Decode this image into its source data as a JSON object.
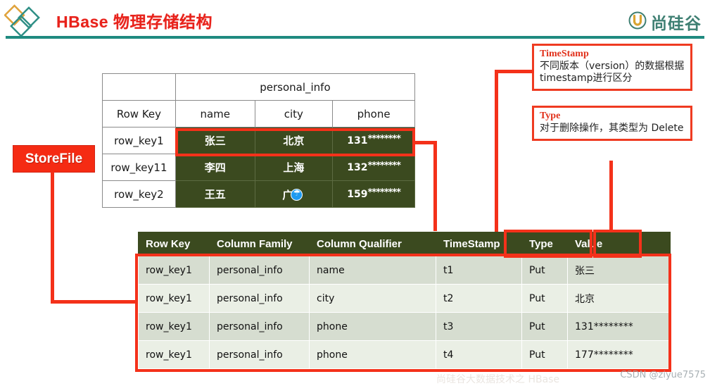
{
  "header": {
    "title": "HBase 物理存储结构",
    "brand_name": "尚硅谷",
    "logo_icon": "diamonds-logo-icon",
    "brand_icon": "u-mark-icon"
  },
  "logical_table": {
    "column_family_label": "personal_info",
    "row_key_header": "Row Key",
    "qualifier_headers": [
      "name",
      "city",
      "phone"
    ],
    "rows": [
      {
        "row_key": "row_key1",
        "name": "张三",
        "city": "北京",
        "city_badge": "umbrella-badge-icon",
        "phone_prefix": "131",
        "phone_stars": "********",
        "highlighted": true
      },
      {
        "row_key": "row_key11",
        "name": "李四",
        "city": "上海",
        "city_badge": "",
        "phone_prefix": "132",
        "phone_stars": "********",
        "highlighted": false
      },
      {
        "row_key": "row_key2",
        "name": "王五",
        "city": "广",
        "city_badge": "umbrella-badge-icon",
        "phone_prefix": "159",
        "phone_stars": "********",
        "highlighted": false
      }
    ]
  },
  "storefile_table": {
    "headers": [
      "Row Key",
      "Column Family",
      "Column Qualifier",
      "TimeStamp",
      "Type",
      "Value"
    ],
    "rows": [
      {
        "row_key": "row_key1",
        "family": "personal_info",
        "qualifier": "name",
        "timestamp": "t1",
        "type": "Put",
        "value": "张三"
      },
      {
        "row_key": "row_key1",
        "family": "personal_info",
        "qualifier": "city",
        "timestamp": "t2",
        "type": "Put",
        "value": "北京"
      },
      {
        "row_key": "row_key1",
        "family": "personal_info",
        "qualifier": "phone",
        "timestamp": "t3",
        "type": "Put",
        "value": "131********"
      },
      {
        "row_key": "row_key1",
        "family": "personal_info",
        "qualifier": "phone",
        "timestamp": "t4",
        "type": "Put",
        "value": "177********"
      }
    ]
  },
  "callouts": {
    "timestamp": {
      "title": "TimeStamp",
      "body": "不同版本（version）的数据根据timestamp进行区分"
    },
    "type": {
      "title": "Type",
      "body": "对于删除操作，其类型为 Delete"
    }
  },
  "storefile_label": "StoreFile",
  "watermark": "CSDN @ziyue7575",
  "watermark_faint": "尚硅谷大数据技术之 HBase",
  "colors": {
    "accent_red": "#f4311a",
    "title_red": "#e8221b",
    "dark_green": "#3b4a1f",
    "teal": "#1f8a80",
    "brand_green": "#3e7f72",
    "row_a": "#d6ddd0",
    "row_b": "#eaefe5"
  }
}
